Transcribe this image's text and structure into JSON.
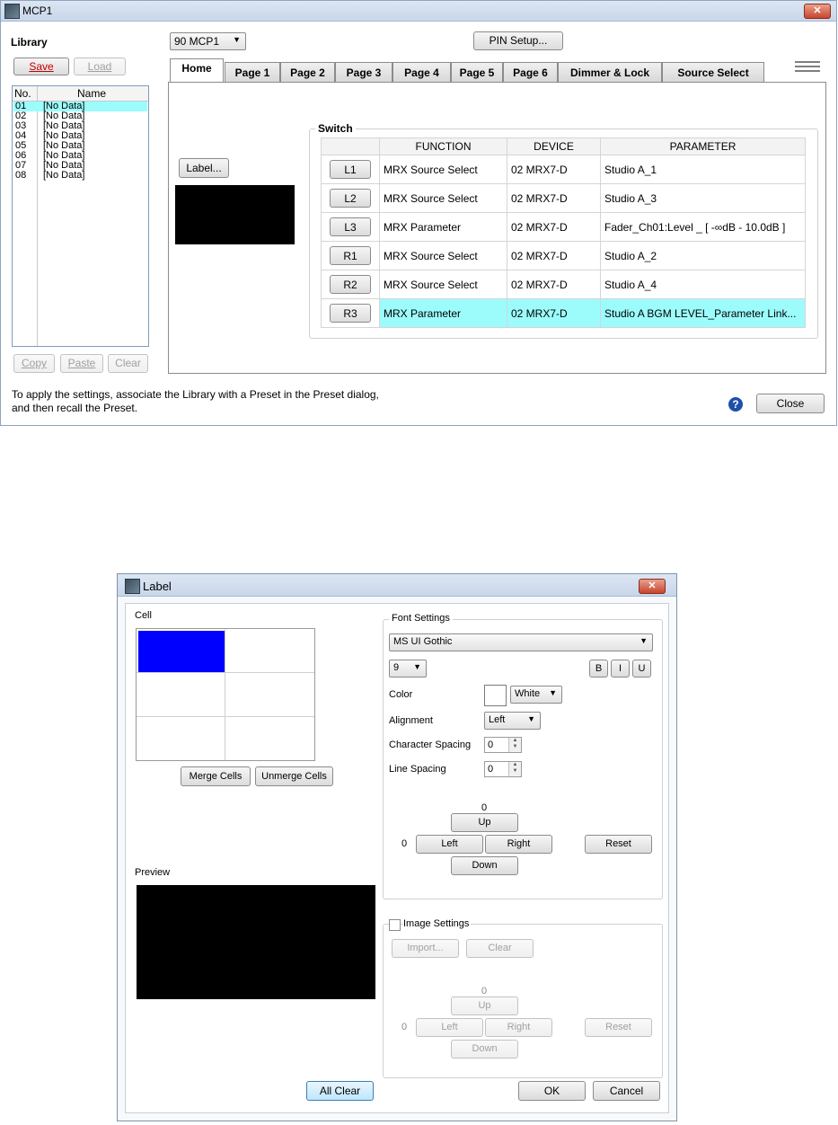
{
  "mcp": {
    "title": "MCP1",
    "library_label": "Library",
    "save": "Save",
    "load": "Load",
    "model_select": "90 MCP1",
    "pin_setup": "PIN Setup...",
    "list_headers": {
      "no": "No.",
      "name": "Name"
    },
    "library_items": [
      {
        "no": "01",
        "name": "[No Data]"
      },
      {
        "no": "02",
        "name": "[No Data]"
      },
      {
        "no": "03",
        "name": "[No Data]"
      },
      {
        "no": "04",
        "name": "[No Data]"
      },
      {
        "no": "05",
        "name": "[No Data]"
      },
      {
        "no": "06",
        "name": "[No Data]"
      },
      {
        "no": "07",
        "name": "[No Data]"
      },
      {
        "no": "08",
        "name": "[No Data]"
      }
    ],
    "copy": "Copy",
    "paste": "Paste",
    "clear": "Clear",
    "tabs": [
      "Home",
      "Page 1",
      "Page 2",
      "Page 3",
      "Page 4",
      "Page 5",
      "Page 6",
      "Dimmer & Lock",
      "Source Select"
    ],
    "label_button": "Label...",
    "switch_group": "Switch",
    "switch_headers": {
      "function": "FUNCTION",
      "device": "DEVICE",
      "parameter": "PARAMETER"
    },
    "switches": [
      {
        "key": "L1",
        "function": "MRX Source Select",
        "device": "02 MRX7-D",
        "parameter": "Studio A_1"
      },
      {
        "key": "L2",
        "function": "MRX Source Select",
        "device": "02 MRX7-D",
        "parameter": "Studio A_3"
      },
      {
        "key": "L3",
        "function": "MRX Parameter",
        "device": "02 MRX7-D",
        "parameter": "Fader_Ch01:Level _ [ -∞dB - 10.0dB ]"
      },
      {
        "key": "R1",
        "function": "MRX Source Select",
        "device": "02 MRX7-D",
        "parameter": "Studio A_2"
      },
      {
        "key": "R2",
        "function": "MRX Source Select",
        "device": "02 MRX7-D",
        "parameter": "Studio A_4"
      },
      {
        "key": "R3",
        "function": "MRX Parameter",
        "device": "02 MRX7-D",
        "parameter": "Studio A BGM LEVEL_Parameter Link..."
      }
    ],
    "footer_line1": "To apply the settings, associate the Library with a Preset in the Preset dialog,",
    "footer_line2": "and then recall the Preset.",
    "close": "Close",
    "help": "?"
  },
  "label_dialog": {
    "title": "Label",
    "cell_label": "Cell",
    "merge": "Merge Cells",
    "unmerge": "Unmerge Cells",
    "preview_label": "Preview",
    "font_settings": "Font Settings",
    "font_name": "MS UI Gothic",
    "font_size": "9",
    "bold": "B",
    "italic": "I",
    "underline": "U",
    "color_label": "Color",
    "color_value": "White",
    "alignment_label": "Alignment",
    "alignment_value": "Left",
    "char_spacing_label": "Character Spacing",
    "char_spacing_value": "0",
    "line_spacing_label": "Line Spacing",
    "line_spacing_value": "0",
    "offset_v": "0",
    "offset_h": "0",
    "up": "Up",
    "left": "Left",
    "right": "Right",
    "down": "Down",
    "reset": "Reset",
    "image_settings": "Image Settings",
    "import": "Import...",
    "img_clear": "Clear",
    "img_offset_v": "0",
    "img_offset_h": "0",
    "all_clear": "All Clear",
    "ok": "OK",
    "cancel": "Cancel"
  },
  "colors": {
    "selection": "#9cfcfc",
    "accent_cell": "#0000ff",
    "title_bar": "#c8d6ea",
    "close_button": "#c8452c"
  }
}
